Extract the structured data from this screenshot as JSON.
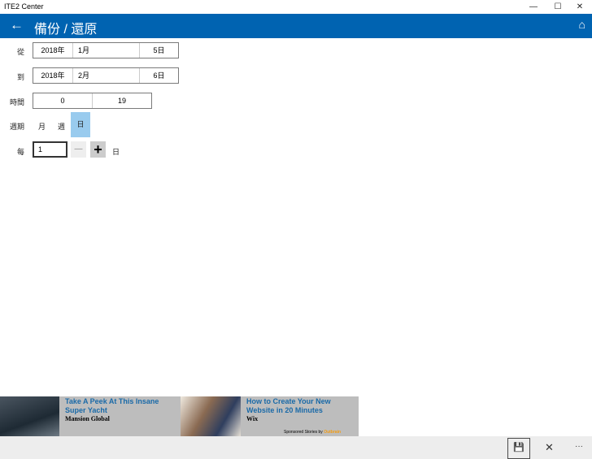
{
  "window": {
    "title": "ITE2 Center",
    "minimize": "—",
    "maximize": "☐",
    "close": "✕"
  },
  "header": {
    "back": "←",
    "title": "備份 / 還原",
    "home": "⌂"
  },
  "from": {
    "label": "從",
    "year": "2018年",
    "month": "1月",
    "day": "5日"
  },
  "to": {
    "label": "到",
    "year": "2018年",
    "month": "2月",
    "day": "6日"
  },
  "time": {
    "label": "時間",
    "start": "0",
    "end": "19"
  },
  "period": {
    "label": "週期",
    "options": [
      "月",
      "週",
      "日"
    ],
    "selected": "日"
  },
  "every": {
    "label": "每",
    "value": "1",
    "minus": "—",
    "plus": "+",
    "unit": "日"
  },
  "ads": [
    {
      "title": "Take A Peek At This Insane Super Yacht",
      "source": "Mansion Global"
    },
    {
      "title": "How to Create Your New Website in 20 Minutes",
      "source": "Wix"
    }
  ],
  "ads_footer": {
    "text": "Sponsored Stories by",
    "brand": "Outbrain"
  },
  "bottombar": {
    "save": "💾",
    "cancel": "✕",
    "more": "···"
  }
}
